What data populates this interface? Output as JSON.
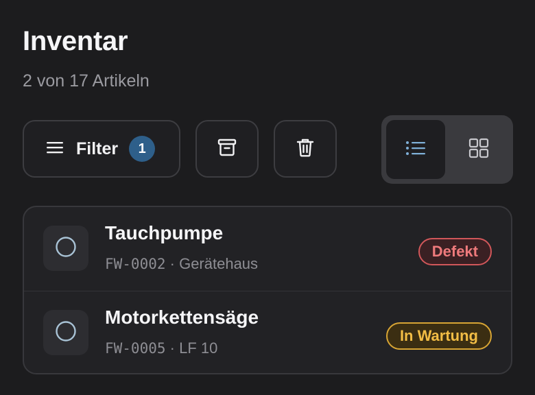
{
  "header": {
    "title": "Inventar",
    "subtitle": "2 von 17 Artikeln"
  },
  "toolbar": {
    "filter_label": "Filter",
    "filter_count": "1",
    "archive_icon": "archive-icon",
    "trash_icon": "trash-icon",
    "view_mode": "list"
  },
  "items": [
    {
      "name": "Tauchpumpe",
      "code": "FW-0002",
      "separator": " · ",
      "location": "Gerätehaus",
      "status": "Defekt",
      "status_color": "#ee7a7c"
    },
    {
      "name": "Motorkettensäge",
      "code": "FW-0005",
      "separator": " · ",
      "location": "LF 10",
      "status": "In Wartung",
      "status_color": "#f2bd45"
    }
  ],
  "colors": {
    "background": "#1c1c1e",
    "accent": "#2e5f8a",
    "list_icon_active": "#7fb0d8"
  }
}
